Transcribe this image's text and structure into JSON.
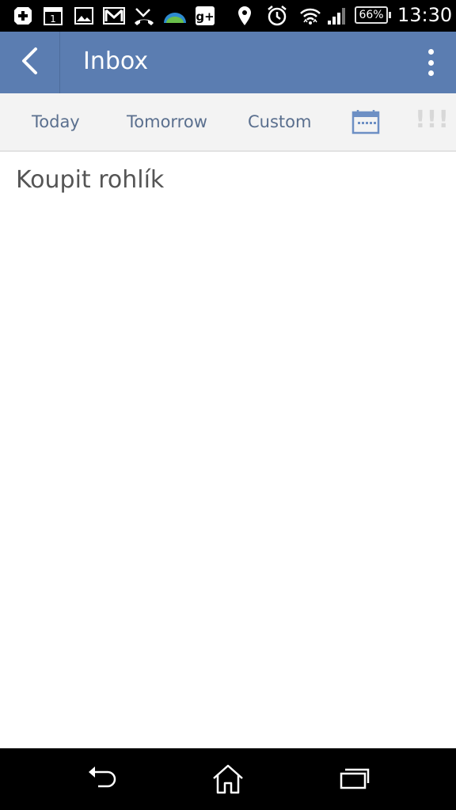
{
  "status_bar": {
    "icons": [
      "health-plus-icon",
      "calendar-day-icon",
      "gallery-icon",
      "gmail-icon",
      "missed-call-icon",
      "weather-icon",
      "google-plus-icon",
      "location-icon",
      "alarm-icon",
      "wifi-icon",
      "signal-icon"
    ],
    "calendar_day": "1",
    "google_plus": "g+",
    "battery": "66%",
    "time": "13:30"
  },
  "app_bar": {
    "title": "Inbox",
    "color": "#5b7db1"
  },
  "date_options": {
    "today": "Today",
    "tomorrow": "Tomorrow",
    "custom": "Custom",
    "priority": "!!!"
  },
  "tasks": [
    {
      "title": "Koupit rohlík"
    }
  ],
  "nav_bar": {
    "icons": [
      "back-icon",
      "home-icon",
      "recent-apps-icon"
    ]
  }
}
